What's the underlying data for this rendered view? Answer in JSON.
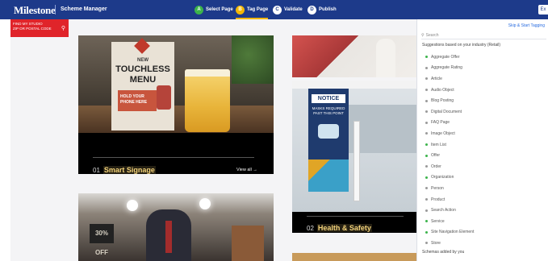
{
  "topbar": {
    "brand": "Milestone",
    "app_name": "Scheme Manager",
    "steps": [
      {
        "index": "A",
        "label": "Select Page",
        "color": "#3cb44b",
        "active": false
      },
      {
        "index": "B",
        "label": "Tag Page",
        "color": "#f2b705",
        "active": true
      },
      {
        "index": "C",
        "label": "Validate",
        "color": "#ffffff",
        "active": false
      },
      {
        "index": "D",
        "label": "Publish",
        "color": "#ffffff",
        "active": false
      }
    ],
    "right_button": "Ex"
  },
  "site": {
    "studio_line1": "FIND MY STUDIO",
    "studio_line2": "ZIP OR POSTAL CODE",
    "cards": [
      {
        "num": "01",
        "title": "Smart Signage",
        "view_all": "View all →",
        "sign_line1": "NEW",
        "sign_line2": "TOUCHLESS",
        "sign_line3": "MENU",
        "sign_cta": "HOLD YOUR PHONE HERE"
      },
      {
        "num": "02",
        "title": "Health & Safety",
        "notice": "NOTICE",
        "notice_text": "MASKS REQUIRED PAST THIS POINT"
      },
      {
        "promo": "30% OFF"
      }
    ]
  },
  "panel": {
    "skip_link": "Skip & Start Tagging",
    "search_placeholder": "Search",
    "suggestions_label": "Suggestions based on your industry (Retail)",
    "items": [
      {
        "label": "Aggregate Offer",
        "color": "#3cb44b"
      },
      {
        "label": "Aggregate Rating",
        "color": "#999999"
      },
      {
        "label": "Article",
        "color": "#999999"
      },
      {
        "label": "Audio Object",
        "color": "#999999"
      },
      {
        "label": "Blog Posting",
        "color": "#999999"
      },
      {
        "label": "Digital Document",
        "color": "#999999"
      },
      {
        "label": "FAQ Page",
        "color": "#999999"
      },
      {
        "label": "Image Object",
        "color": "#999999"
      },
      {
        "label": "Item List",
        "color": "#3cb44b"
      },
      {
        "label": "Offer",
        "color": "#3cb44b"
      },
      {
        "label": "Order",
        "color": "#999999"
      },
      {
        "label": "Organization",
        "color": "#3cb44b"
      },
      {
        "label": "Person",
        "color": "#999999"
      },
      {
        "label": "Product",
        "color": "#999999"
      },
      {
        "label": "Search Action",
        "color": "#999999"
      },
      {
        "label": "Service",
        "color": "#3cb44b"
      },
      {
        "label": "Site Navigation Element",
        "color": "#3cb44b"
      },
      {
        "label": "Store",
        "color": "#999999"
      }
    ],
    "added_label": "Schemas added by you"
  }
}
